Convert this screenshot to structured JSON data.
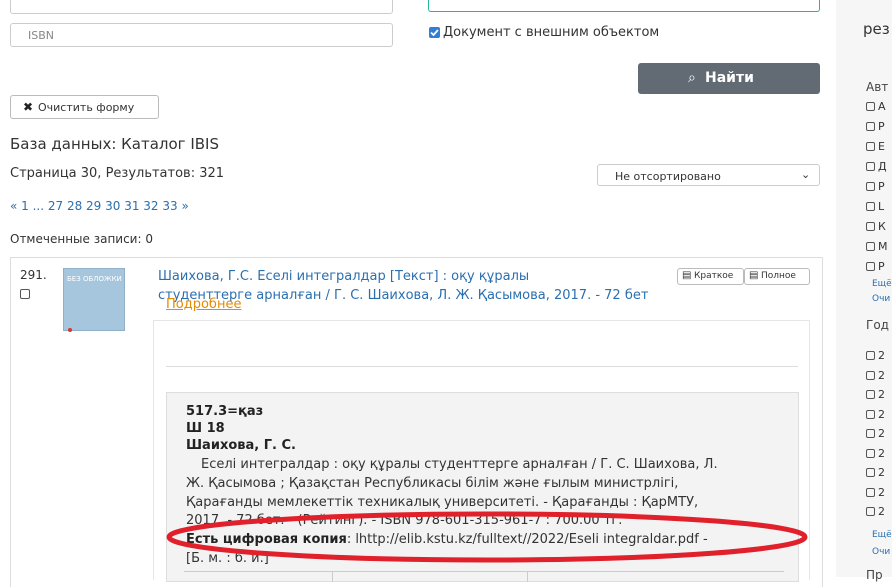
{
  "form": {
    "isbn_placeholder": "ISBN",
    "external_object_label": "Документ с внешним объектом",
    "clear_label": "Очистить форму",
    "search_label": "Найти"
  },
  "results": {
    "database_label": "База данных: Каталог IBIS",
    "page_info": "Страница 30, Результатов: 321",
    "sort_value": "Не отсортировано",
    "pagination": "« 1 ... 27 28 29 30 31 32 33 »",
    "marked": "Отмеченные записи: 0"
  },
  "record": {
    "number": "291.",
    "cover_text": "БЕЗ ОБЛОЖКИ",
    "title_line1": "Шаихова, Г.С. Еселі интегралдар [Текст] : оқу құралы",
    "title_line2": "студенттерге арналған / Г. С. Шаихова, Л. Ж. Қасымова, 2017. - 72 бет",
    "short_label": "Краткое",
    "full_label": "Полное",
    "more_label": "Подробнее",
    "detail": {
      "udc": "517.3=қаз",
      "code": "Ш 18",
      "author": "Шаихова, Г. С.",
      "line1": "Еселі интегралдар : оқу құралы студенттерге арналған / Г. С. Шаихова, Л.",
      "line2": "Ж. Қасымова ; Қазақстан Республикасы білім және ғылым министрлігі,",
      "line3": "Қарағанды мемлекеттік техникалық университеті. - Қарағанды : ҚарМТУ,",
      "line4": "2017. - 72 бет. - (Рейтинг). - ISBN 978-601-315-961-7 : 700.00 тг.",
      "digital_label": "Есть цифровая копия",
      "digital_value": ": lhttp://elib.kstu.kz/fulltext//2022/Eseli integraldar.pdf -",
      "line6": "[Б. м. : б. и.]"
    }
  },
  "sidebar": {
    "heading_top": "рез",
    "authors_heading": "Авт",
    "author_items": [
      "А",
      "Р",
      "Е",
      "Д",
      "Р",
      "L",
      "К",
      "М",
      "Р"
    ],
    "more_label": "Ещё",
    "clear_label": "Очи",
    "years_heading": "Год",
    "year_items": [
      "2",
      "2",
      "2",
      "2",
      "2",
      "2",
      "2",
      "2",
      "2"
    ],
    "more_label2": "Ещё",
    "clear_label2": "Очи",
    "bottom_heading": "Пр"
  },
  "colors": {
    "search_button": "#626a73",
    "highlight_circle": "#e0202a",
    "accent_link": "#e68a00",
    "teal_border": "#22b8a0"
  }
}
